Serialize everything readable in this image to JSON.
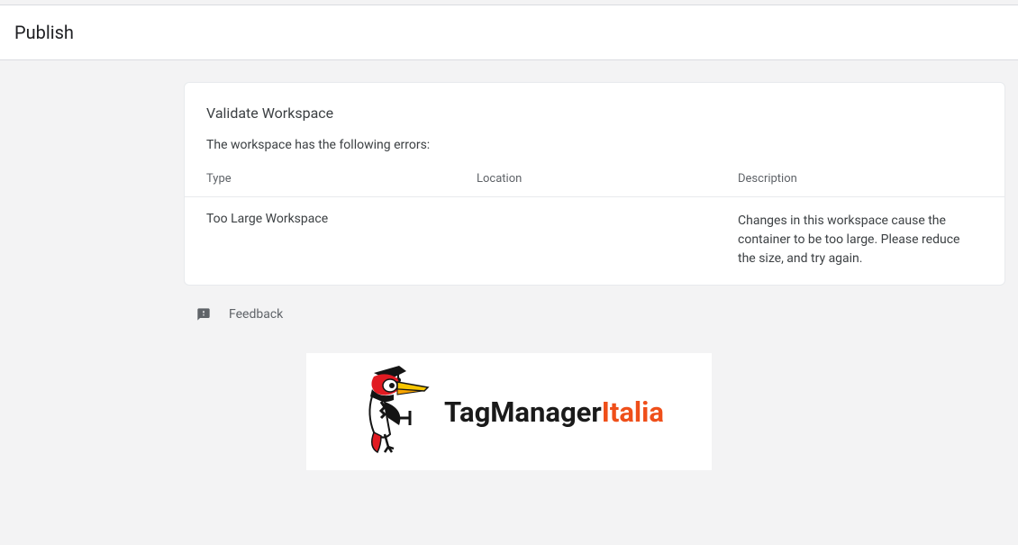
{
  "header": {
    "title": "Publish"
  },
  "card": {
    "title": "Validate Workspace",
    "subtitle": "The workspace has the following errors:",
    "columns": {
      "type": "Type",
      "location": "Location",
      "description": "Description"
    },
    "rows": [
      {
        "type": "Too Large Workspace",
        "location": "",
        "description": "Changes in this workspace cause the container to be too large. Please reduce the size, and try again."
      }
    ]
  },
  "feedback": {
    "label": "Feedback"
  },
  "logo": {
    "part1": "TagManager",
    "part2": "Italia"
  }
}
